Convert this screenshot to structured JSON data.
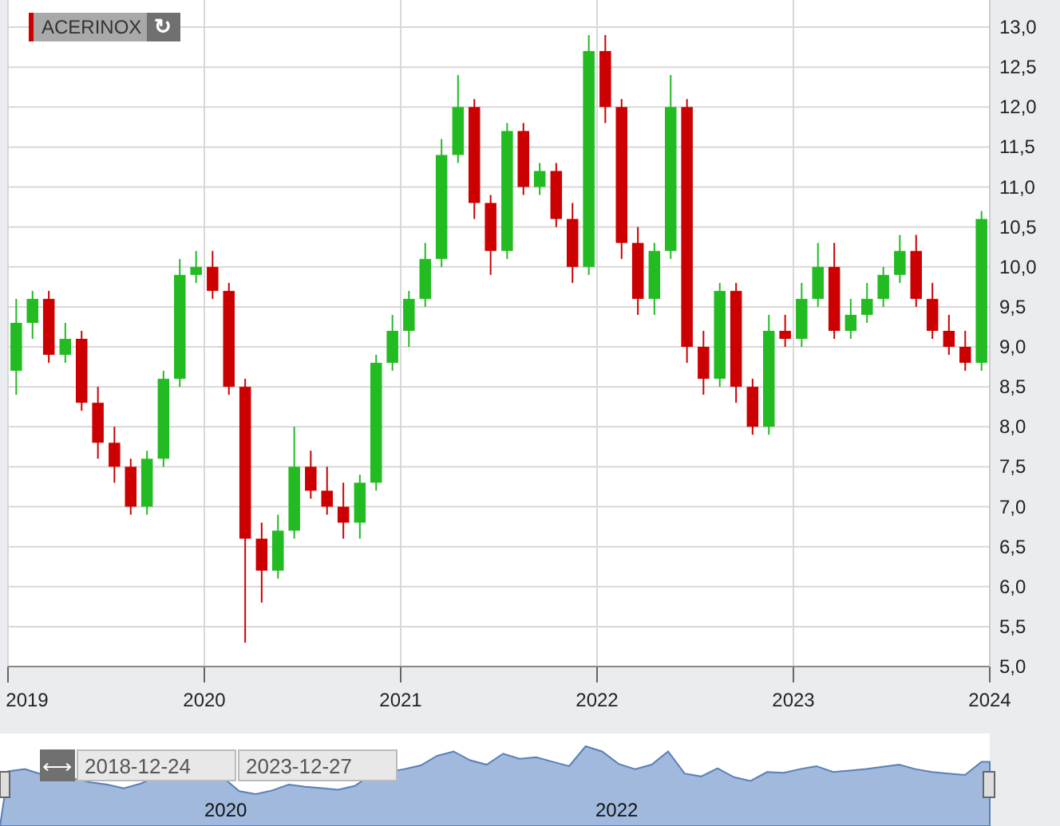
{
  "legend": {
    "label": "ACERINOX",
    "color": "#cc0000",
    "refresh_symbol": "↻"
  },
  "chart_data": {
    "type": "candlestick",
    "ylim": [
      5,
      13
    ],
    "grid": true,
    "yticks": [
      {
        "value": 5,
        "label": "5,0"
      },
      {
        "value": 5.5,
        "label": "5,5"
      },
      {
        "value": 6,
        "label": "6,0"
      },
      {
        "value": 6.5,
        "label": "6,5"
      },
      {
        "value": 7,
        "label": "7,0"
      },
      {
        "value": 7.5,
        "label": "7,5"
      },
      {
        "value": 8,
        "label": "8,0"
      },
      {
        "value": 8.5,
        "label": "8,5"
      },
      {
        "value": 9,
        "label": "9,0"
      },
      {
        "value": 9.5,
        "label": "9,5"
      },
      {
        "value": 10,
        "label": "10,0"
      },
      {
        "value": 10.5,
        "label": "10,5"
      },
      {
        "value": 11,
        "label": "11,0"
      },
      {
        "value": 11.5,
        "label": "11,5"
      },
      {
        "value": 12,
        "label": "12,0"
      },
      {
        "value": 12.5,
        "label": "12,5"
      },
      {
        "value": 13,
        "label": "13,0"
      }
    ],
    "xlim": [
      2019,
      2024
    ],
    "xticks": [
      {
        "value": 2019,
        "label": "2019"
      },
      {
        "value": 2020,
        "label": "2020"
      },
      {
        "value": 2021,
        "label": "2021"
      },
      {
        "value": 2022,
        "label": "2022"
      },
      {
        "value": 2023,
        "label": "2023"
      },
      {
        "value": 2024,
        "label": "2024"
      }
    ],
    "x": [
      2019.042,
      2019.125,
      2019.208,
      2019.292,
      2019.375,
      2019.458,
      2019.542,
      2019.625,
      2019.708,
      2019.792,
      2019.875,
      2019.958,
      2020.042,
      2020.125,
      2020.208,
      2020.292,
      2020.375,
      2020.458,
      2020.542,
      2020.625,
      2020.708,
      2020.792,
      2020.875,
      2020.958,
      2021.042,
      2021.125,
      2021.208,
      2021.292,
      2021.375,
      2021.458,
      2021.542,
      2021.625,
      2021.708,
      2021.792,
      2021.875,
      2021.958,
      2022.042,
      2022.125,
      2022.208,
      2022.292,
      2022.375,
      2022.458,
      2022.542,
      2022.625,
      2022.708,
      2022.792,
      2022.875,
      2022.958,
      2023.042,
      2023.125,
      2023.208,
      2023.292,
      2023.375,
      2023.458,
      2023.542,
      2023.625,
      2023.708,
      2023.792,
      2023.875,
      2023.958
    ],
    "ohlc": [
      [
        8.7,
        9.6,
        8.4,
        9.3
      ],
      [
        9.3,
        9.7,
        9.1,
        9.6
      ],
      [
        9.6,
        9.7,
        8.8,
        8.9
      ],
      [
        8.9,
        9.3,
        8.8,
        9.1
      ],
      [
        9.1,
        9.2,
        8.2,
        8.3
      ],
      [
        8.3,
        8.5,
        7.6,
        7.8
      ],
      [
        7.8,
        8.0,
        7.3,
        7.5
      ],
      [
        7.5,
        7.6,
        6.9,
        7.0
      ],
      [
        7.0,
        7.7,
        6.9,
        7.6
      ],
      [
        7.6,
        8.7,
        7.5,
        8.6
      ],
      [
        8.6,
        10.1,
        8.5,
        9.9
      ],
      [
        9.9,
        10.2,
        9.8,
        10.0
      ],
      [
        10.0,
        10.2,
        9.6,
        9.7
      ],
      [
        9.7,
        9.8,
        8.4,
        8.5
      ],
      [
        8.5,
        8.6,
        5.3,
        6.6
      ],
      [
        6.6,
        6.8,
        5.8,
        6.2
      ],
      [
        6.2,
        6.9,
        6.1,
        6.7
      ],
      [
        6.7,
        8.0,
        6.6,
        7.5
      ],
      [
        7.5,
        7.7,
        7.1,
        7.2
      ],
      [
        7.2,
        7.5,
        6.9,
        7.0
      ],
      [
        7.0,
        7.3,
        6.6,
        6.8
      ],
      [
        6.8,
        7.4,
        6.6,
        7.3
      ],
      [
        7.3,
        8.9,
        7.2,
        8.8
      ],
      [
        8.8,
        9.4,
        8.7,
        9.2
      ],
      [
        9.2,
        9.7,
        9.0,
        9.6
      ],
      [
        9.6,
        10.3,
        9.5,
        10.1
      ],
      [
        10.1,
        11.6,
        10.0,
        11.4
      ],
      [
        11.4,
        12.4,
        11.3,
        12.0
      ],
      [
        12.0,
        12.1,
        10.6,
        10.8
      ],
      [
        10.8,
        10.9,
        9.9,
        10.2
      ],
      [
        10.2,
        11.8,
        10.1,
        11.7
      ],
      [
        11.7,
        11.8,
        10.9,
        11.0
      ],
      [
        11.0,
        11.3,
        10.9,
        11.2
      ],
      [
        11.2,
        11.3,
        10.5,
        10.6
      ],
      [
        10.6,
        10.8,
        9.8,
        10.0
      ],
      [
        10.0,
        12.9,
        9.9,
        12.7
      ],
      [
        12.7,
        12.9,
        11.8,
        12.0
      ],
      [
        12.0,
        12.1,
        10.1,
        10.3
      ],
      [
        10.3,
        10.5,
        9.4,
        9.6
      ],
      [
        9.6,
        10.3,
        9.4,
        10.2
      ],
      [
        10.2,
        12.4,
        10.1,
        12.0
      ],
      [
        12.0,
        12.1,
        8.8,
        9.0
      ],
      [
        9.0,
        9.2,
        8.4,
        8.6
      ],
      [
        8.6,
        9.8,
        8.5,
        9.7
      ],
      [
        9.7,
        9.8,
        8.3,
        8.5
      ],
      [
        8.5,
        8.6,
        7.9,
        8.0
      ],
      [
        8.0,
        9.4,
        7.9,
        9.2
      ],
      [
        9.2,
        9.4,
        9.0,
        9.1
      ],
      [
        9.1,
        9.8,
        9.0,
        9.6
      ],
      [
        9.6,
        10.3,
        9.5,
        10.0
      ],
      [
        10.0,
        10.3,
        9.1,
        9.2
      ],
      [
        9.2,
        9.6,
        9.1,
        9.4
      ],
      [
        9.4,
        9.8,
        9.3,
        9.6
      ],
      [
        9.6,
        10.0,
        9.5,
        9.9
      ],
      [
        9.9,
        10.4,
        9.8,
        10.2
      ],
      [
        10.2,
        10.4,
        9.5,
        9.6
      ],
      [
        9.6,
        9.8,
        9.1,
        9.2
      ],
      [
        9.2,
        9.4,
        8.9,
        9.0
      ],
      [
        9.0,
        9.2,
        8.7,
        8.8
      ],
      [
        8.8,
        10.7,
        8.7,
        10.6
      ]
    ]
  },
  "navigator": {
    "range_symbol": "⟷",
    "from": "2018-12-24",
    "to": "2023-12-27",
    "year_labels": [
      "2020",
      "2022"
    ]
  }
}
